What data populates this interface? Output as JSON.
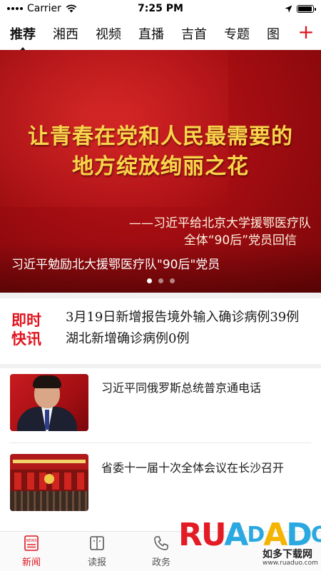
{
  "status_bar": {
    "carrier": "Carrier",
    "time": "7:25 PM",
    "battery_level": 0.95
  },
  "channels": {
    "tabs": [
      {
        "label": "推荐",
        "active": true
      },
      {
        "label": "湘西",
        "active": false
      },
      {
        "label": "视频",
        "active": false
      },
      {
        "label": "直播",
        "active": false
      },
      {
        "label": "吉首",
        "active": false
      },
      {
        "label": "专题",
        "active": false
      },
      {
        "label": "图",
        "active": false
      }
    ],
    "add_label": "+"
  },
  "banner": {
    "headline_line1": "让青春在党和人民最需要的",
    "headline_line2": "地方绽放绚丽之花",
    "attribution_line1": "——习近平给北京大学援鄂医疗队",
    "attribution_line2": "全体“90后”党员回信",
    "caption": "习近平勉励北大援鄂医疗队\"90后\"党员",
    "slide_count": 3,
    "active_slide": 1
  },
  "flash_news": {
    "badge_line1": "即时",
    "badge_line2": "快讯",
    "text": "3月19日新增报告境外输入确诊病例39例  湖北新增确诊病例0例"
  },
  "news": [
    {
      "title": "习近平同俄罗斯总统普京通电话",
      "thumb_icon": "portrait-photo"
    },
    {
      "title": "省委十一届十次全体会议在长沙召开",
      "thumb_icon": "meeting-hall-photo"
    }
  ],
  "bottom_nav": [
    {
      "label": "新闻",
      "icon": "news-icon",
      "active": true
    },
    {
      "label": "读报",
      "icon": "newspaper-icon",
      "active": false
    },
    {
      "label": "政务",
      "icon": "phone-icon",
      "active": false
    }
  ],
  "watermark": {
    "brand": "RUANDAOO",
    "sub": "如多下载网",
    "url": "www.ruaduo.com"
  },
  "colors": {
    "accent": "#e0141e",
    "banner_red": "#a30d12",
    "headline_gold": "#f8d54a"
  }
}
